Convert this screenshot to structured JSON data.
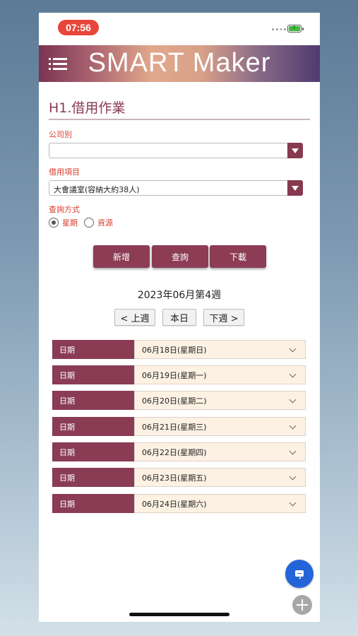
{
  "status_bar": {
    "time": "07:56"
  },
  "header": {
    "brand": "SMART Maker"
  },
  "page": {
    "title": "H1.借用作業"
  },
  "form": {
    "company_label": "公司別",
    "company_value": "",
    "item_label": "借用項目",
    "item_value": "大會議室(容納大約38人)",
    "query_label": "查詢方式",
    "query_options": [
      {
        "label": "星期",
        "checked": true
      },
      {
        "label": "資源",
        "checked": false
      }
    ]
  },
  "actions": {
    "add": "新增",
    "query": "查詢",
    "download": "下載"
  },
  "week": {
    "title": "2023年06月第4週",
    "prev": "< 上週",
    "today": "本日",
    "next": "下週 >"
  },
  "schedule": {
    "date_label": "日期",
    "dates": [
      "06月18日(星期日)",
      "06月19日(星期一)",
      "06月20日(星期二)",
      "06月21日(星期三)",
      "06月22日(星期四)",
      "06月23日(星期五)",
      "06月24日(星期六)"
    ]
  },
  "colors": {
    "accent": "#8a3c55",
    "label_red": "#d63a2a",
    "row_bg": "#fdf1e3",
    "fab_blue": "#2464d9"
  },
  "icons": [
    "hamburger-icon",
    "chevron-down-icon",
    "chat-icon",
    "plus-icon",
    "battery-icon"
  ]
}
